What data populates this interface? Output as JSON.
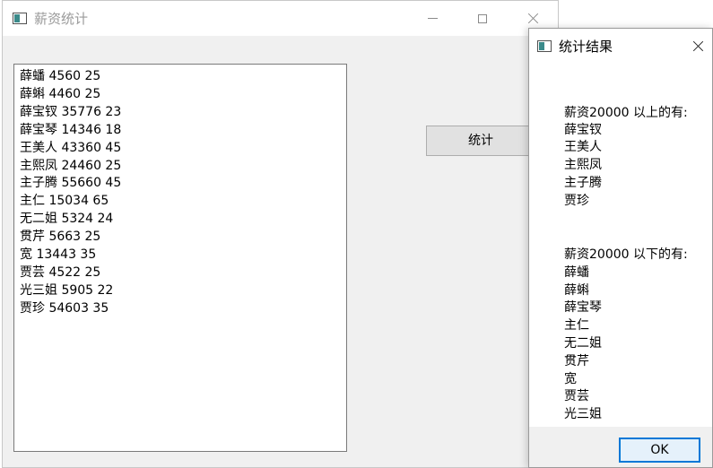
{
  "main_window": {
    "title": "薪资统计",
    "text_lines": [
      "薛蟠 4560 25",
      "薛蝌 4460 25",
      "薛宝钗 35776 23",
      "薛宝琴 14346 18",
      "王美人 43360 45",
      "主熙凤 24460 25",
      "主子腾 55660 45",
      "主仁 15034 65",
      "无二姐 5324 24",
      "贯芹 5663 25",
      "宽 13443 35",
      "贾芸 4522 25",
      "光三姐 5905 22",
      "贾珍 54603 35"
    ],
    "stat_button_label": "统计",
    "controls": {
      "minimize_icon": "minimize-icon",
      "maximize_icon": "maximize-icon",
      "close_icon": "close-icon"
    }
  },
  "dialog": {
    "title": "统计结果",
    "above_header": "薪资20000 以上的有:",
    "above_names": [
      "薛宝钗",
      "王美人",
      "主熙凤",
      "主子腾",
      "贾珍"
    ],
    "below_header": "薪资20000 以下的有:",
    "below_names": [
      "薛蟠",
      "薛蝌",
      "薛宝琴",
      "主仁",
      "无二姐",
      "贯芹",
      "宽",
      "贾芸",
      "光三姐"
    ],
    "ok_label": "OK"
  },
  "colors": {
    "titlebar": "#ffffff",
    "client_area": "#f0f0f0",
    "focus_border": "#0078d7",
    "icon_accent": "#3a8a8a"
  }
}
